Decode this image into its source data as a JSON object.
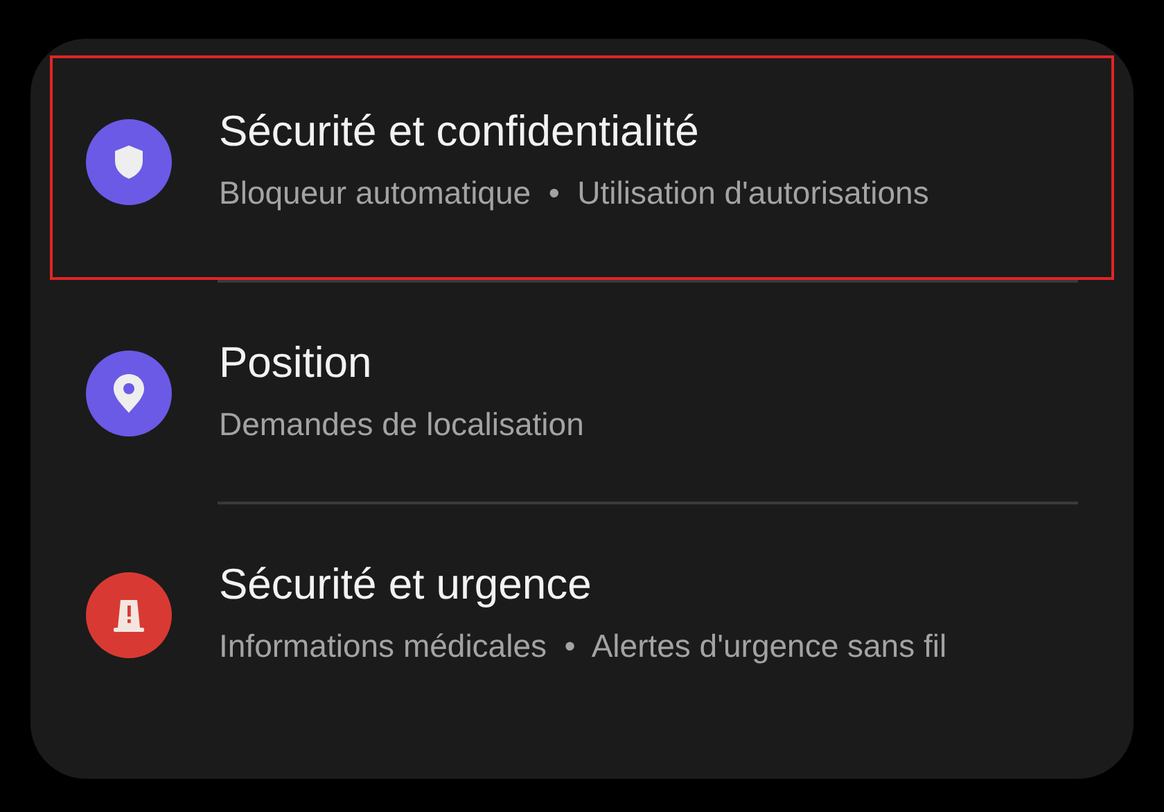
{
  "items": [
    {
      "kind": "shield",
      "title": "Sécurité et confidentialité",
      "subtitle": "Bloqueur automatique  •  Utilisation d'autorisations",
      "color": "#6a5ae6",
      "highlighted": true
    },
    {
      "kind": "pin",
      "title": "Position",
      "subtitle": "Demandes de localisation",
      "color": "#6a5ae6",
      "highlighted": false
    },
    {
      "kind": "beacon",
      "title": "Sécurité et urgence",
      "subtitle": "Informations médicales  •  Alertes d'urgence sans fil",
      "color": "#d83a33",
      "highlighted": false
    }
  ]
}
